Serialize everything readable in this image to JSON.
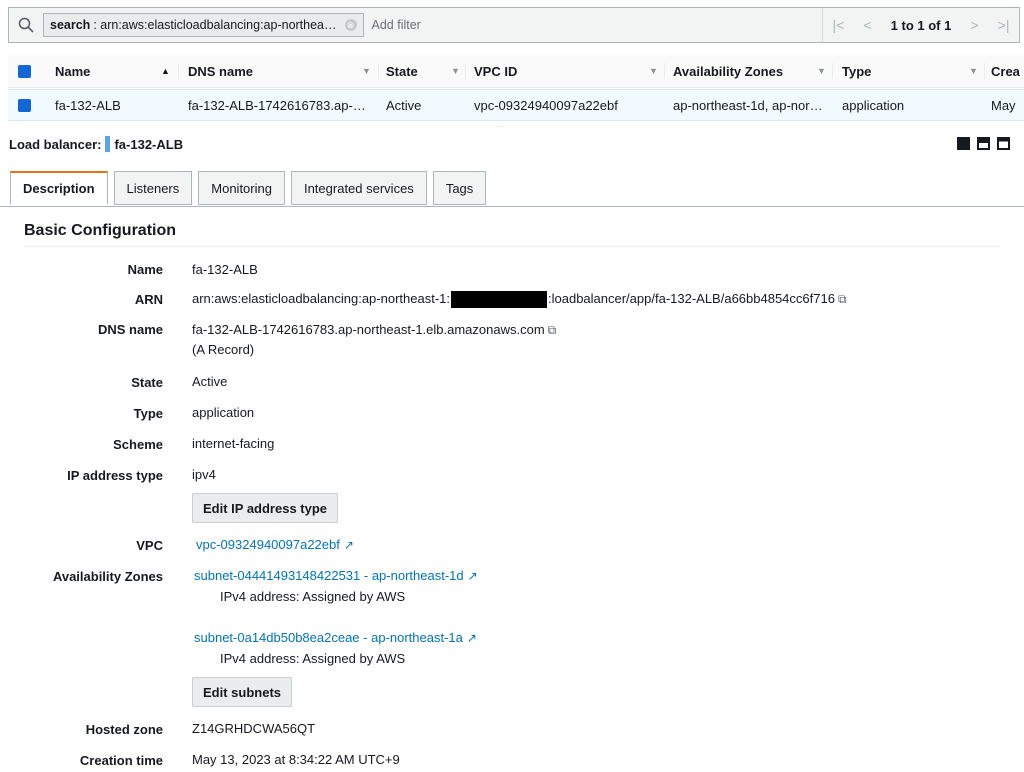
{
  "filter": {
    "token_key": "search",
    "token_value": ": arn:aws:elasticloadbalancing:ap-northea…",
    "token_clear": "⊗",
    "add_filter": "Add filter",
    "pager_first": "|<",
    "pager_prev": "<",
    "pager_count": "1 to 1 of 1",
    "pager_next": ">",
    "pager_last": ">|"
  },
  "table": {
    "columns": [
      "Name",
      "DNS name",
      "State",
      "VPC ID",
      "Availability Zones",
      "Type",
      "Crea"
    ],
    "row": [
      "fa-132-ALB",
      "fa-132-ALB-1742616783.ap-…",
      "Active",
      "vpc-09324940097a22ebf",
      "ap-northeast-1d, ap-nor…",
      "application",
      "May"
    ]
  },
  "detail": {
    "title_label": "Load balancer:",
    "title_name": "fa-132-ALB",
    "tabs": [
      "Description",
      "Listeners",
      "Monitoring",
      "Integrated services",
      "Tags"
    ],
    "section_title": "Basic Configuration",
    "fields": {
      "name_label": "Name",
      "name_value": "fa-132-ALB",
      "arn_label": "ARN",
      "arn_prefix": "arn:aws:elasticloadbalancing:ap-northeast-1:",
      "arn_suffix": ":loadbalancer/app/fa-132-ALB/a66bb4854cc6f716",
      "dns_label": "DNS name",
      "dns_value": "fa-132-ALB-1742616783.ap-northeast-1.elb.amazonaws.com",
      "dns_record": "(A Record)",
      "state_label": "State",
      "state_value": "Active",
      "type_label": "Type",
      "type_value": "application",
      "scheme_label": "Scheme",
      "scheme_value": "internet-facing",
      "ip_label": "IP address type",
      "ip_value": "ipv4",
      "edit_ip_button": "Edit IP address type",
      "vpc_label": "VPC",
      "vpc_value": "vpc-09324940097a22ebf",
      "az_label": "Availability Zones",
      "subnet1": "subnet-04441493148422531 - ap-northeast-1d",
      "subnet1_ip": "IPv4 address: Assigned by AWS",
      "subnet2": "subnet-0a14db50b8ea2ceae - ap-northeast-1a",
      "subnet2_ip": "IPv4 address: Assigned by AWS",
      "edit_subnets_button": "Edit subnets",
      "hosted_zone_label": "Hosted zone",
      "hosted_zone_value": "Z14GRHDCWA56QT",
      "creation_label": "Creation time",
      "creation_value": "May 13, 2023 at 8:34:22 AM UTC+9"
    }
  }
}
